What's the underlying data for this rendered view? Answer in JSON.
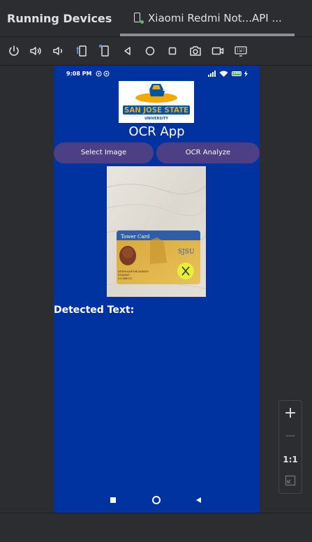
{
  "panel": {
    "title": "Running Devices"
  },
  "device_tab": {
    "label": "Xiaomi Redmi Not...API ...",
    "status": "running"
  },
  "toolbar": {
    "tools": [
      "power-icon",
      "volume-up-icon",
      "volume-down-icon",
      "rotate-left-icon",
      "rotate-right-icon",
      "back-icon",
      "home-icon",
      "overview-icon",
      "camera-icon",
      "screen-record-icon",
      "keyboard-icon"
    ]
  },
  "phone": {
    "status_bar": {
      "time": "9:08 PM",
      "battery": "100"
    },
    "logo_text": "SAN JOSE STATE",
    "logo_subtext": "UNIVERSITY",
    "app_title": "OCR App",
    "buttons": {
      "select_image": "Select Image",
      "ocr_analyze": "OCR Analyze"
    },
    "card": {
      "title": "Tower Card",
      "brand": "SJSU",
      "name": "NITHIN KARTHIK KAMATH",
      "role": "STUDENT",
      "id": "017488722"
    },
    "detected_label": "Detected Text:"
  },
  "zoom": {
    "zoom_in": "+",
    "zoom_out": "—",
    "actual_size": "1:1"
  },
  "colors": {
    "phone_bg": "#0033a0",
    "button_bg": "#4c3f86",
    "ide_bg": "#2b2d30"
  }
}
